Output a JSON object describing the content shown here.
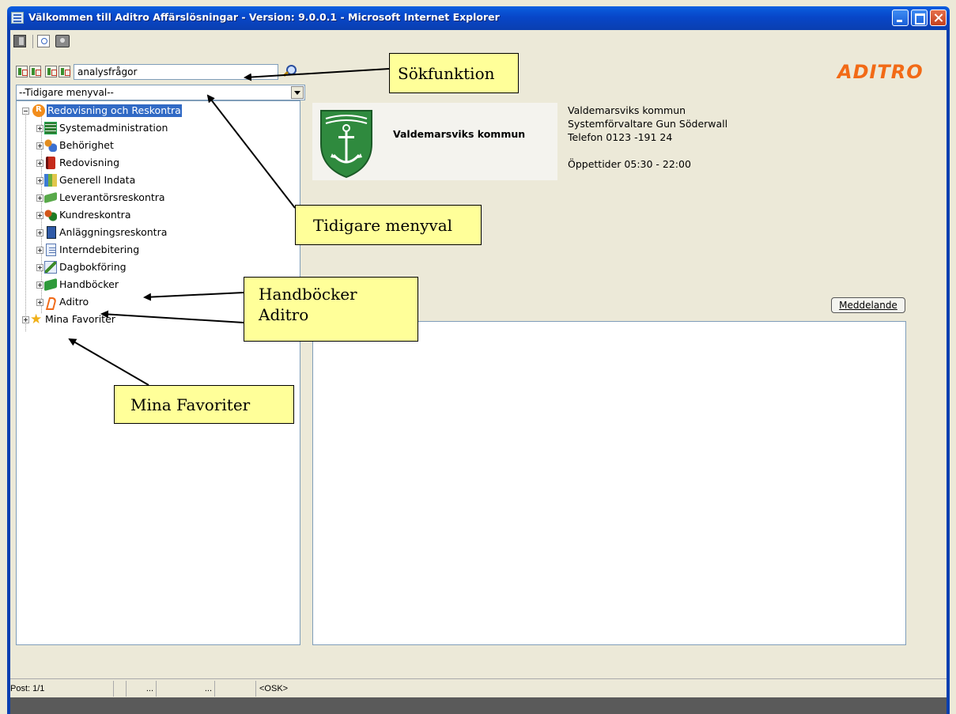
{
  "window": {
    "title": "Välkommen till Aditro Affärslösningar - Version: 9.0.0.1 - Microsoft Internet Explorer"
  },
  "toolbar": {
    "icons": [
      "exit-icon",
      "preview-icon",
      "camera-icon"
    ]
  },
  "left_panel": {
    "search": {
      "value": "analysfrågor"
    },
    "history_select": {
      "value": "--Tidigare menyval--"
    },
    "tree": {
      "root": "Redovisning och Reskontra",
      "children": [
        "Systemadministration",
        "Behörighet",
        "Redovisning",
        "Generell Indata",
        "Leverantörsreskontra",
        "Kundreskontra",
        "Anläggningsreskontra",
        "Interndebitering",
        "Dagbokföring",
        "Handböcker",
        "Aditro"
      ],
      "favorites": "Mina Favoriter"
    }
  },
  "right_panel": {
    "logo": "ADITRO",
    "municipality_name": "Valdemarsviks kommun",
    "info": {
      "line1": "Valdemarsviks kommun",
      "line2": "Systemförvaltare Gun Söderwall",
      "line3": "Telefon 0123 -191 24",
      "line4": "Öppettider 05:30 - 22:00"
    },
    "message_button": "Meddelande"
  },
  "callouts": {
    "search": "Sökfunktion",
    "history": "Tidigare menyval",
    "handbooks_line1": "Handböcker",
    "handbooks_line2": "Aditro",
    "favorites": "Mina Favoriter"
  },
  "statusbar": {
    "post": "Post: 1/1",
    "cell3": "...",
    "cell4": "...",
    "osk": "<OSK>"
  },
  "colors": {
    "titlebar": "#0846c8",
    "selection": "#316ac5",
    "aditro_orange": "#f26a16",
    "callout_fill": "#ffff99",
    "crest_green": "#2f8a3e"
  }
}
